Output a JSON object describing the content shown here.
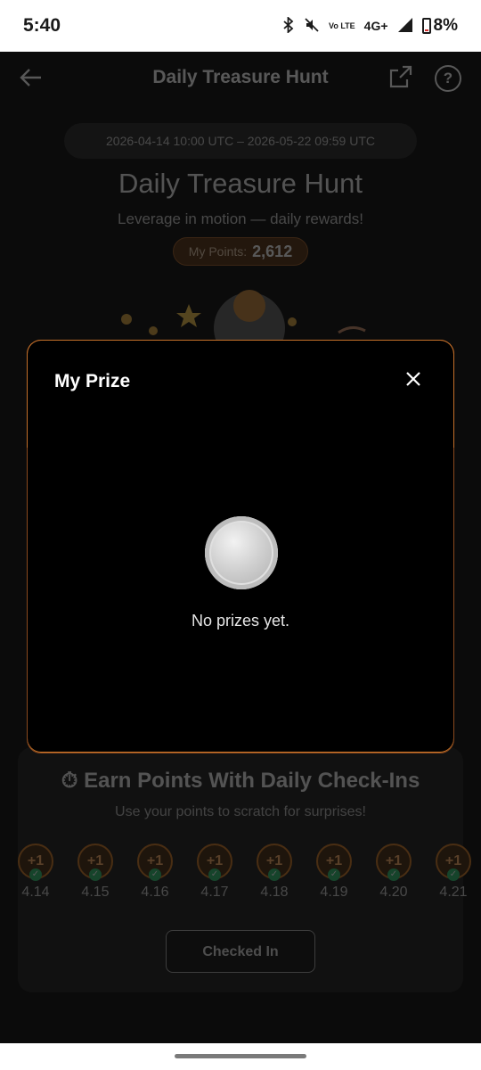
{
  "status_bar": {
    "time": "5:40",
    "network": "4G+",
    "volte": "Vo LTE",
    "battery": "8%"
  },
  "page": {
    "title": "Daily Treasure Hunt",
    "date_range": "2026-04-14 10:00 UTC – 2026-05-22 09:59 UTC",
    "hero_title": "Daily Treasure Hunt",
    "hero_subtitle": "Leverage in motion — daily rewards!",
    "points_label": "My Points:",
    "points_value": "2,612"
  },
  "checkin": {
    "title": "Earn Points With Daily Check-Ins",
    "subtitle": "Use your points to scratch for surprises!",
    "days": [
      {
        "reward": "+1",
        "date": "4.14"
      },
      {
        "reward": "+1",
        "date": "4.15"
      },
      {
        "reward": "+1",
        "date": "4.16"
      },
      {
        "reward": "+1",
        "date": "4.17"
      },
      {
        "reward": "+1",
        "date": "4.18"
      },
      {
        "reward": "+1",
        "date": "4.19"
      },
      {
        "reward": "+1",
        "date": "4.20"
      },
      {
        "reward": "+1",
        "date": "4.21"
      }
    ],
    "button_label": "Checked In"
  },
  "modal": {
    "title": "My Prize",
    "empty_text": "No prizes yet."
  },
  "colors": {
    "accent": "#d07a28",
    "check_green": "#2fbf71",
    "modal_border": "#c4702a"
  }
}
